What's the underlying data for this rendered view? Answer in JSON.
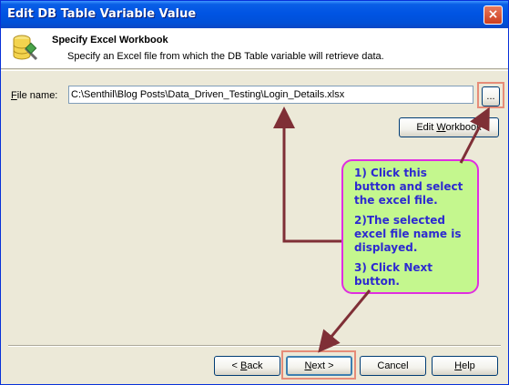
{
  "window": {
    "title": "Edit DB Table Variable Value",
    "close_glyph": "×"
  },
  "header": {
    "title": "Specify Excel Workbook",
    "subtitle": "Specify an Excel file from which the DB Table variable will retrieve data.",
    "icon": "database-excel-icon"
  },
  "file": {
    "label_accel": "F",
    "label_rest": "ile name:",
    "value": "C:\\Senthil\\Blog Posts\\Data_Driven_Testing\\Login_Details.xlsx",
    "browse_label": "...",
    "edit_label_pre": "Edit ",
    "edit_label_accel": "W",
    "edit_label_post": "orkbook"
  },
  "callout": {
    "step1": "1) Click this button and select the excel file.",
    "step2": "2)The selected excel file name is displayed.",
    "step3": "3) Click Next button."
  },
  "buttons": {
    "back_pre": "< ",
    "back_accel": "B",
    "back_post": "ack",
    "next_accel": "N",
    "next_post": "ext >",
    "cancel": "Cancel",
    "help_accel": "H",
    "help_post": "elp"
  },
  "colors": {
    "callout_bg": "#c4f78e",
    "callout_border": "#e02ee0",
    "callout_text": "#2d2ad0",
    "arrow": "#7f2f36",
    "highlight": "#e68c78"
  }
}
